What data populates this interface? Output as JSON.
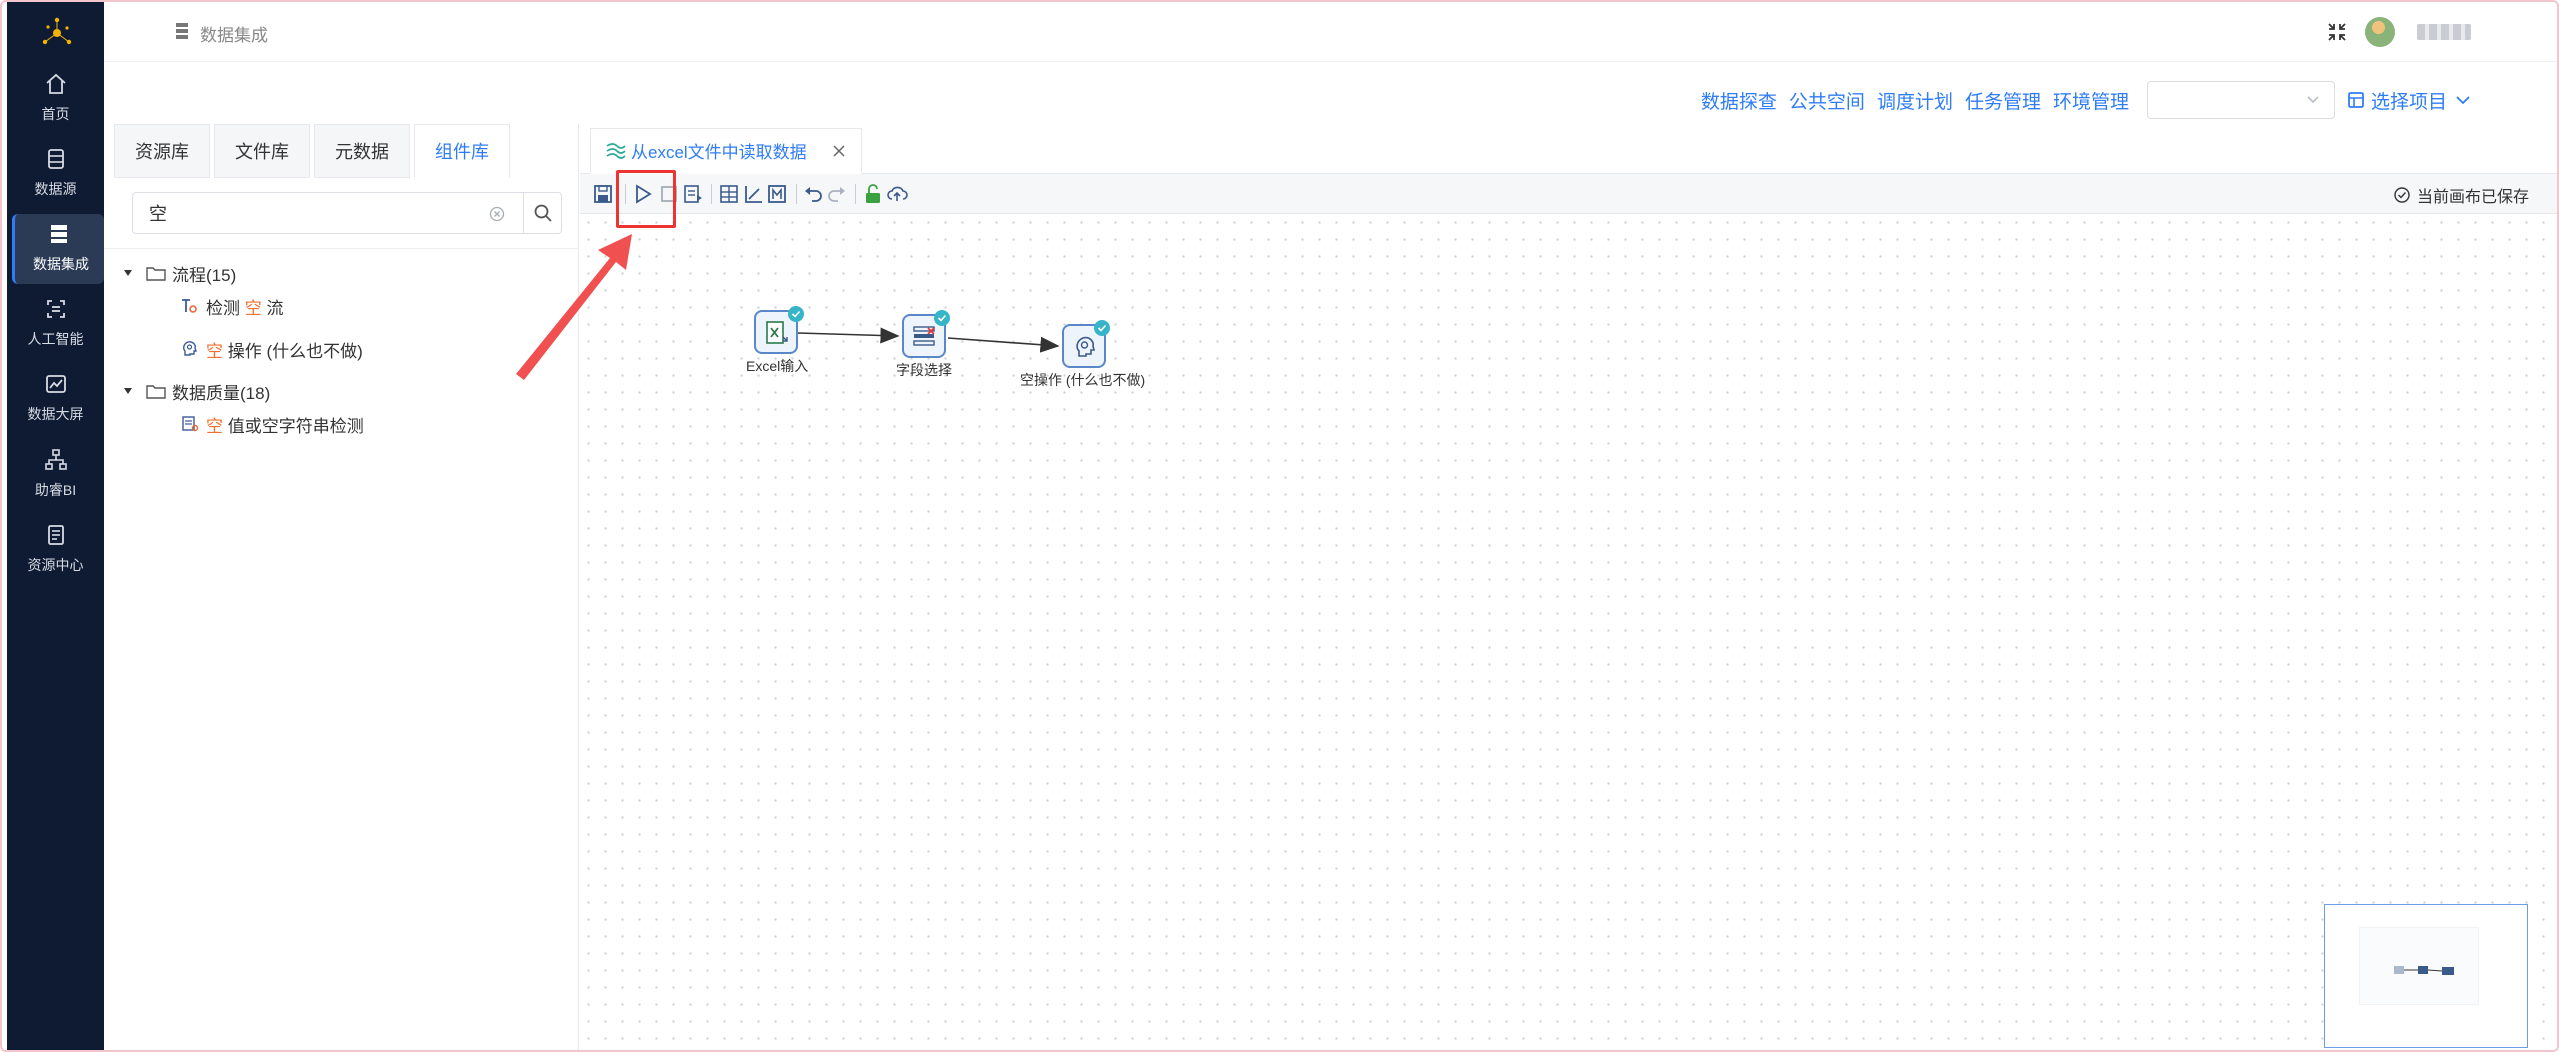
{
  "sidebar": {
    "items": [
      {
        "label": "首页",
        "icon": "home-icon"
      },
      {
        "label": "数据源",
        "icon": "database-icon"
      },
      {
        "label": "数据集成",
        "icon": "integration-icon",
        "active": true
      },
      {
        "label": "人工智能",
        "icon": "ai-icon"
      },
      {
        "label": "数据大屏",
        "icon": "chart-icon"
      },
      {
        "label": "助睿BI",
        "icon": "org-tree-icon"
      },
      {
        "label": "资源中心",
        "icon": "document-icon"
      }
    ]
  },
  "header": {
    "title": "数据集成"
  },
  "topmenu": {
    "items": [
      "数据探查",
      "公共空间",
      "调度计划",
      "任务管理",
      "环境管理"
    ],
    "select_value": "",
    "project_label": "选择项目"
  },
  "leftpanel": {
    "tabs": [
      "资源库",
      "文件库",
      "元数据",
      "组件库"
    ],
    "active_tab": "组件库",
    "search_value": "空",
    "tree": {
      "group1": {
        "label": "流程(15)"
      },
      "group1_items": [
        {
          "pre": "检测 ",
          "hl": "空",
          "post": " 流"
        },
        {
          "pre": "",
          "hl": "空",
          "post": " 操作 (什么也不做)"
        }
      ],
      "group2": {
        "label": "数据质量(18)"
      },
      "group2_items": [
        {
          "pre": "",
          "hl": "空",
          "post": " 值或空字符串检测"
        }
      ]
    }
  },
  "editor": {
    "tab_title": "从excel文件中读取数据",
    "saved_status": "当前画布已保存",
    "nodes": [
      {
        "label": "Excel输入"
      },
      {
        "label": "字段选择"
      },
      {
        "label": "空操作 (什么也不做)"
      }
    ]
  },
  "colors": {
    "accent": "#2f7df6",
    "sidebar_bg": "#0f1b33",
    "highlight": "#f07030",
    "annotation_red": "#e33333",
    "check_teal": "#36b5c8"
  }
}
